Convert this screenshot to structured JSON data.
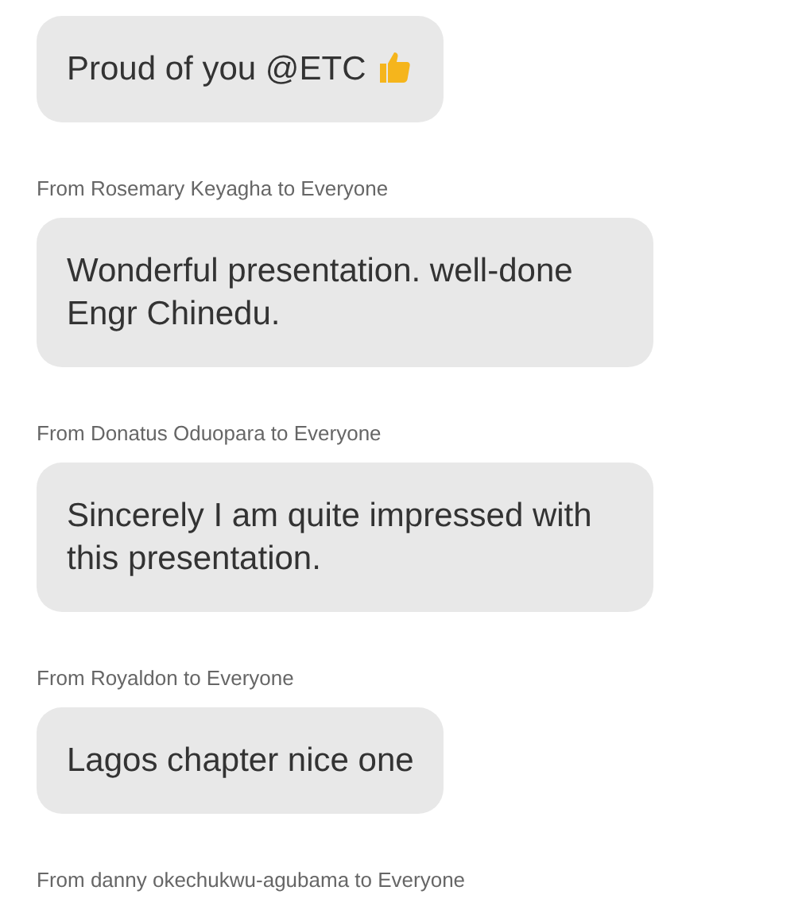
{
  "messages": [
    {
      "kind": "with-icon",
      "text": "Proud of you @ETC"
    },
    {
      "sender": "From Rosemary Keyagha to Everyone",
      "text": "Wonderful presentation. well-done Engr Chinedu."
    },
    {
      "sender": "From Donatus Oduopara to Everyone",
      "text": "Sincerely I am quite impressed with this presentation."
    },
    {
      "sender": "From Royaldon to Everyone",
      "text": "Lagos chapter nice one"
    },
    {
      "sender": "From danny okechukwu-agubama to Everyone"
    }
  ]
}
